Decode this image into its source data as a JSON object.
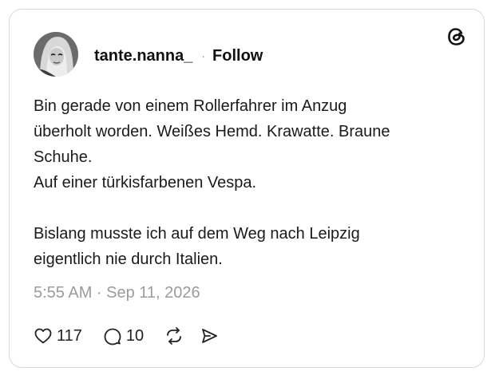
{
  "post": {
    "username": "tante.nanna_",
    "separator": "·",
    "follow_label": "Follow",
    "body": "Bin gerade von einem Rollerfahrer im Anzug\nüberholt worden. Weißes Hemd. Krawatte. Braune\nSchuhe.\nAuf einer türkisfarbenen Vespa.\n\nBislang musste ich auf dem Weg nach Leipzig\neigentlich nie durch Italien.",
    "timestamp": "5:55 AM · Sep 11, 2026"
  },
  "actions": {
    "likes": "117",
    "replies": "10"
  },
  "icons": {
    "brand": "threads-logo-icon",
    "like": "heart-icon",
    "reply": "speech-bubble-icon",
    "repost": "repost-icon",
    "share": "send-icon"
  },
  "colors": {
    "text": "#111111",
    "muted": "#9b9b9b",
    "border": "#d9d9d9"
  }
}
